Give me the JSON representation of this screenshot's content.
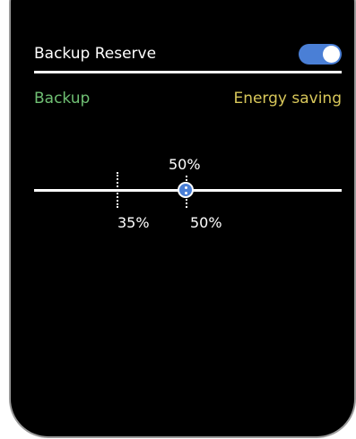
{
  "header": {
    "title": "Backup Reserve",
    "toggle_on": true
  },
  "slider": {
    "left_label": "Backup",
    "right_label": "Energy saving",
    "top_value": "50%",
    "min_marker": "35%",
    "current_value": "50%",
    "level_percent": 50,
    "min_percent": 35
  },
  "colors": {
    "background": "#000000",
    "accent": "#4a7fd6",
    "backup_label": "#6fbf73",
    "energy_label": "#d8c75a"
  }
}
